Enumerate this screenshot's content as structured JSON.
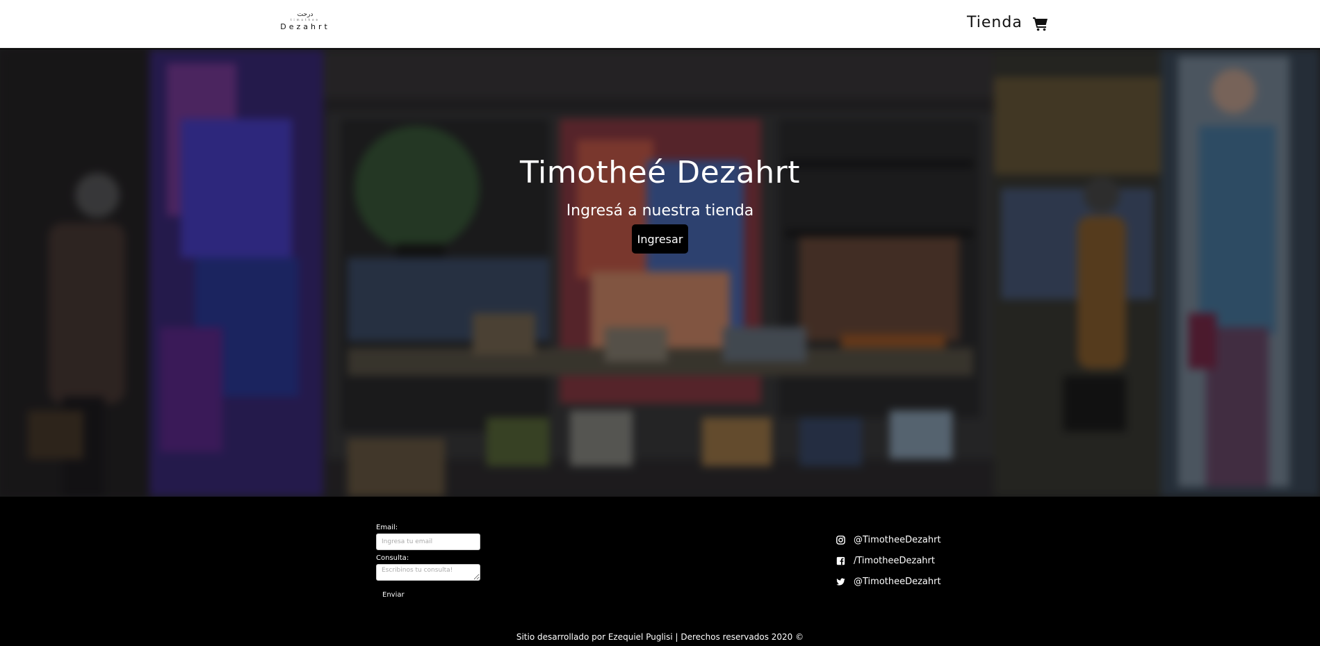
{
  "header": {
    "logo": {
      "mark": "ﺩﺭﺣﺖ",
      "sub": "timothee",
      "name": "Dezahrt"
    },
    "nav_link": "Tienda",
    "cart_icon": "shopping-cart-icon"
  },
  "hero": {
    "title": "Timotheé Dezahrt",
    "subtitle": "Ingresá a nuestra tienda",
    "button_label": "Ingresar"
  },
  "contact_form": {
    "email_label": "Email:",
    "email_placeholder": "Ingresa tu email",
    "email_value": "",
    "consulta_label": "Consulta:",
    "consulta_placeholder": "Escribinos tu consulta!",
    "consulta_value": "",
    "send_label": "Enviar"
  },
  "social": [
    {
      "icon": "instagram-icon",
      "label": "@TimotheeDezahrt"
    },
    {
      "icon": "facebook-icon",
      "label": "/TimotheeDezahrt"
    },
    {
      "icon": "twitter-icon",
      "label": "@TimotheeDezahrt"
    }
  ],
  "footer": {
    "copyright": "Sitio desarrollado por Ezequiel Puglisi | Derechos reservados 2020 ©"
  },
  "colors": {
    "header_bg": "#ffffff",
    "footer_bg": "#000000",
    "button_bg": "#000000",
    "text_light": "#ffffff"
  }
}
